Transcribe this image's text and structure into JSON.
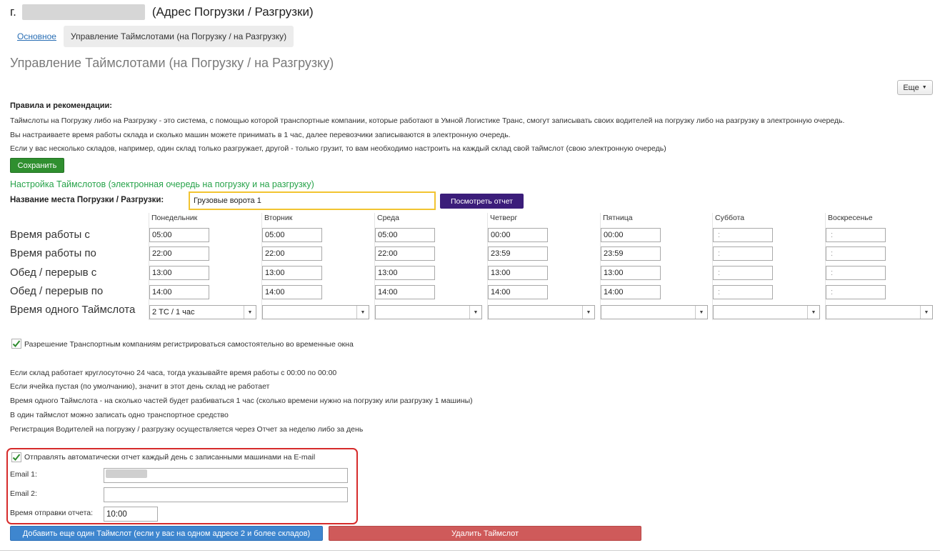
{
  "header": {
    "prefix": "г.",
    "suffix": "(Адрес Погрузки / Разгрузки)"
  },
  "tabs": [
    {
      "label": "Основное"
    },
    {
      "label": "Управление Таймслотами (на Погрузку / на Разгрузку)"
    }
  ],
  "page_title": "Управление Таймслотами (на Погрузку / на Разгрузку)",
  "more_button": {
    "label": "Еще",
    "icon": "triangle-down-icon"
  },
  "rules": {
    "heading": "Правила и рекомендации:",
    "lines": [
      "Таймслоты на Погрузку либо на Разгрузку - это система, с помощью которой транспортные компании, которые работают в Умной Логистике Транс, смогут записывать своих водителей на погрузку либо на разгрузку в электронную очередь.",
      "Вы настраиваете время работы склада и сколько машин можете принимать в 1 час, далее перевозчики записываются в электронную очередь.",
      "Если у вас несколько складов, например, один склад только разгружает, другой - только грузит, то вам необходимо настроить на каждый склад свой таймслот (свою электронную очередь)"
    ]
  },
  "save_button": "Сохранить",
  "settings": {
    "heading": "Настройка Таймслотов (электронная очередь на погрузку и на разгрузку)",
    "place_label": "Название места Погрузки / Разгрузки:",
    "place_value": "Грузовые ворота 1",
    "report_button": "Посмотреть отчет"
  },
  "schedule": {
    "days": [
      "Понедельник",
      "Вторник",
      "Среда",
      "Четверг",
      "Пятница",
      "Суббота",
      "Воскресенье"
    ],
    "rows": [
      {
        "label": "Время работы с",
        "values": [
          "05:00",
          "05:00",
          "05:00",
          "00:00",
          "00:00",
          " :",
          " :"
        ]
      },
      {
        "label": "Время работы по",
        "values": [
          "22:00",
          "22:00",
          "22:00",
          "23:59",
          "23:59",
          " :",
          " :"
        ]
      },
      {
        "label": "Обед / перерыв с",
        "values": [
          "13:00",
          "13:00",
          "13:00",
          "13:00",
          "13:00",
          " :",
          " :"
        ]
      },
      {
        "label": "Обед / перерыв по",
        "values": [
          "14:00",
          "14:00",
          "14:00",
          "14:00",
          "14:00",
          " :",
          " :"
        ]
      }
    ],
    "slot_row": {
      "label": "Время одного Таймслота",
      "values": [
        "2 ТС / 1 час",
        "",
        "",
        "",
        "",
        "",
        ""
      ]
    }
  },
  "permission": {
    "checked": true,
    "label": "Разрешение Транспортным компаниям регистрироваться самостоятельно во временные окна"
  },
  "notes": [
    "Если склад работает круглосуточно 24 часа, тогда указывайте время работы с 00:00 по 00:00",
    "Если ячейка пустая (по умолчанию), значит в этот день склад не работает",
    "Время одного Таймслота - на сколько частей будет разбиваться 1 час (сколько времени нужно на погрузку или разгрузку 1 машины)",
    "В один таймслот можно записать одно транспортное средство",
    "Регистрация Водителей на погрузку  / разгрузку осуществляется через Отчет за неделю либо за день"
  ],
  "email_settings": {
    "auto_send_checked": true,
    "auto_send_label": "Отправлять автоматически отчет каждый день с записанными машинами на E-mail",
    "email1_label": "Email 1:",
    "email2_label": "Email 2:",
    "email2_value": "",
    "send_time_label": "Время отправки отчета:",
    "send_time_value": "10:00"
  },
  "add_button": "Добавить еще один Таймслот (если у вас на одном адресе 2 и более складов)",
  "delete_button": "Удалить Таймслот",
  "colors": {
    "save_green": "#2f8f2f",
    "section_green": "#27a34a",
    "report_purple": "#3b1d7a",
    "add_blue": "#3e86cf",
    "delete_red": "#cf5a5a",
    "highlight_red": "#d62b2b",
    "input_yellow": "#f2c431"
  }
}
